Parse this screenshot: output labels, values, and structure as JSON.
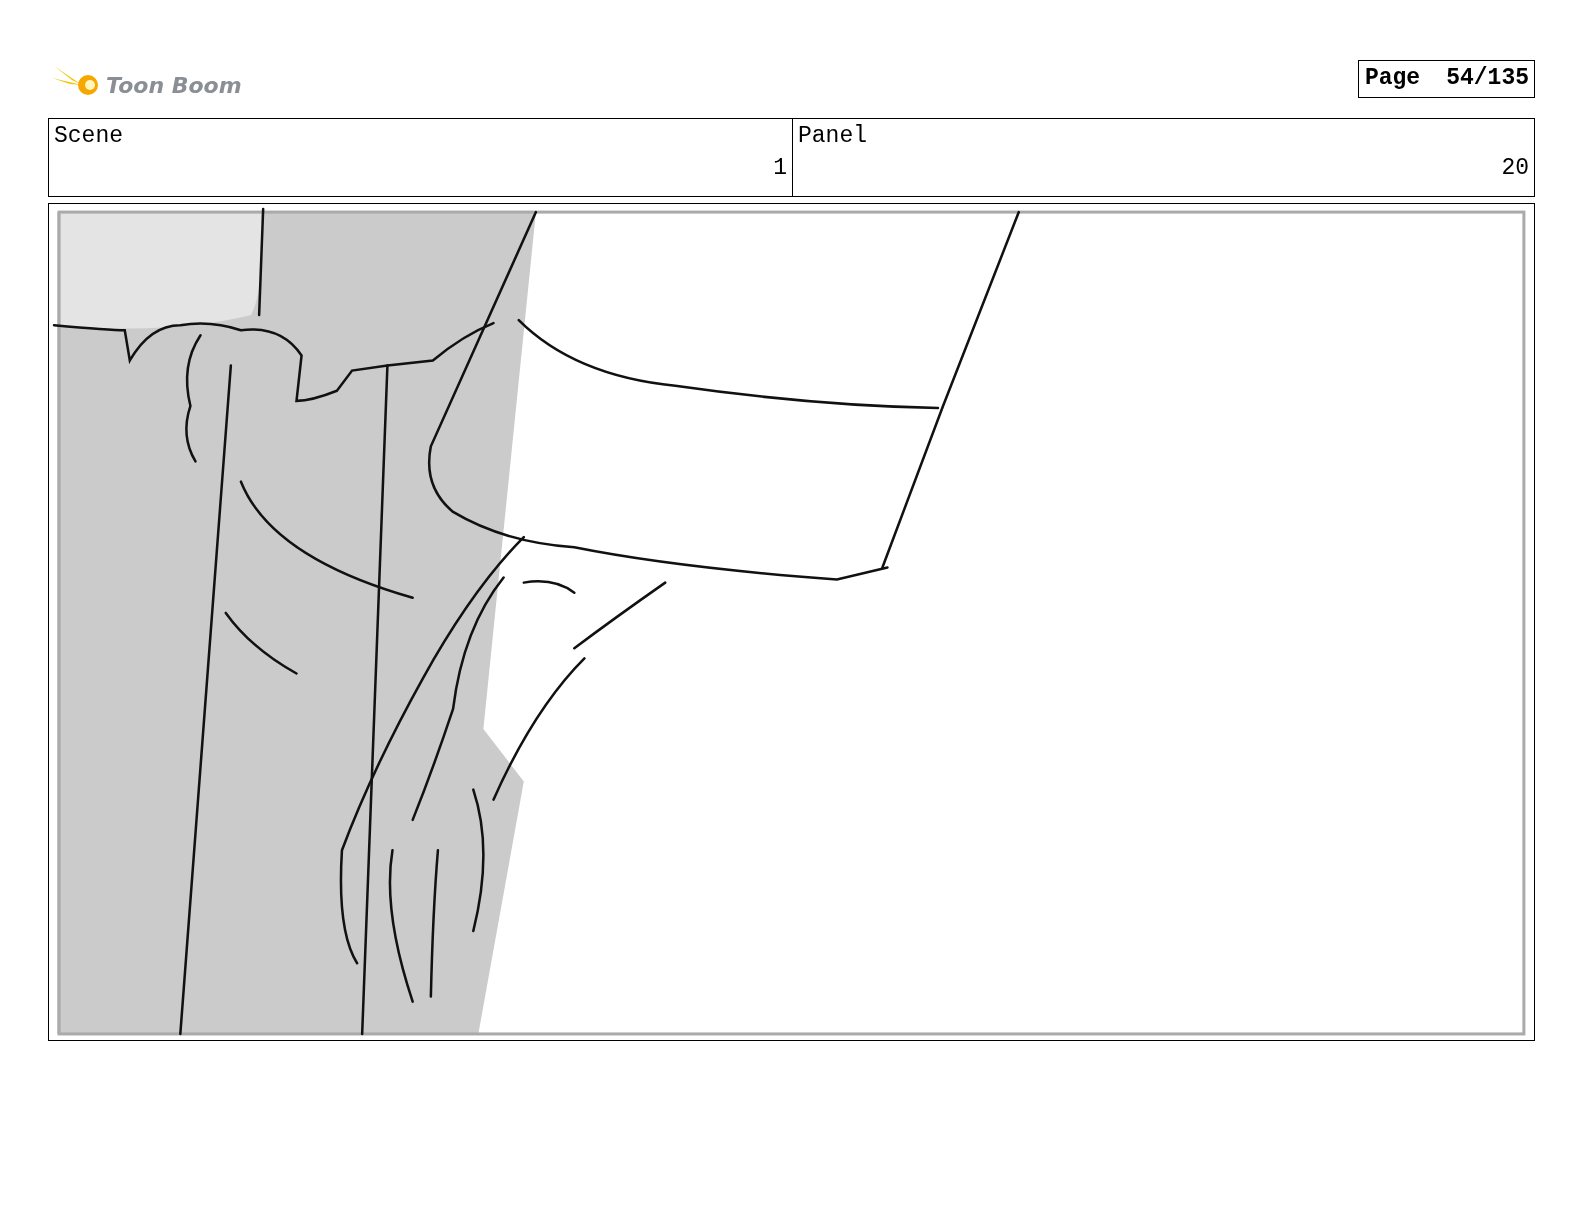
{
  "logo": {
    "text": "Toon Boom"
  },
  "page": {
    "label": "Page",
    "number": "54/135"
  },
  "scene": {
    "label": "Scene",
    "value": "1"
  },
  "panel": {
    "label": "Panel",
    "value": "20"
  }
}
